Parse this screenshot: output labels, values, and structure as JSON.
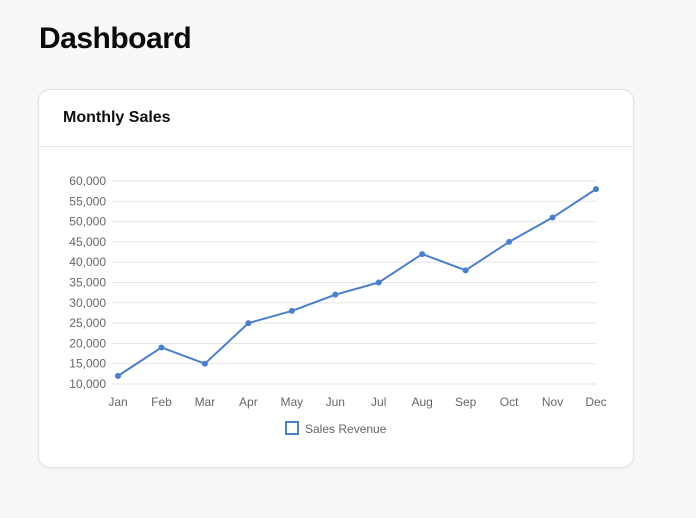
{
  "page": {
    "title": "Dashboard"
  },
  "card": {
    "title": "Monthly Sales"
  },
  "chart_data": {
    "type": "line",
    "title": "Monthly Sales",
    "categories": [
      "Jan",
      "Feb",
      "Mar",
      "Apr",
      "May",
      "Jun",
      "Jul",
      "Aug",
      "Sep",
      "Oct",
      "Nov",
      "Dec"
    ],
    "series": [
      {
        "name": "Sales Revenue",
        "values": [
          12000,
          19000,
          15000,
          25000,
          28000,
          32000,
          35000,
          42000,
          38000,
          45000,
          51000,
          58000
        ],
        "color": "#4a7fd0"
      }
    ],
    "ylim": [
      10000,
      60000
    ],
    "yticks": [
      10000,
      15000,
      20000,
      25000,
      30000,
      35000,
      40000,
      45000,
      50000,
      55000,
      60000
    ],
    "ytick_labels": [
      "10,000",
      "15,000",
      "20,000",
      "25,000",
      "30,000",
      "35,000",
      "40,000",
      "45,000",
      "50,000",
      "55,000",
      "60,000"
    ],
    "xlabel": "",
    "ylabel": "",
    "grid": true,
    "legend_position": "bottom"
  }
}
